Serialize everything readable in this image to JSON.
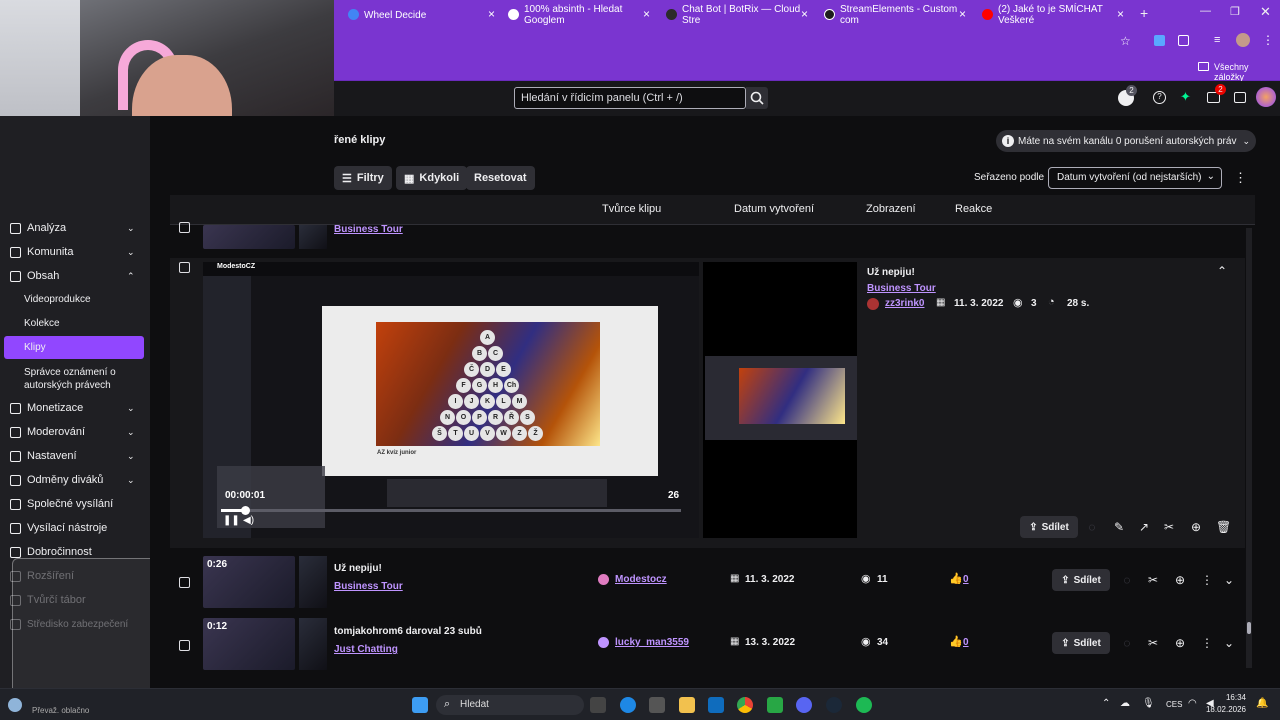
{
  "browser": {
    "tabs": [
      {
        "label": "Wheel Decide",
        "favicon_color": "#4285f4"
      },
      {
        "label": "100% absinth - Hledat Googlem",
        "favicon_color": "#ffffff"
      },
      {
        "label": "Chat Bot | BotRix — Cloud Stre",
        "favicon_color": "#2b2b2b"
      },
      {
        "label": "StreamElements - Custom com",
        "favicon_color": "#1d1d1d"
      },
      {
        "label": "(2) Jaké to je SMÍCHAT Veškeré",
        "favicon_color": "#ff0000"
      }
    ],
    "new_tab": "+",
    "bookmarks_all": "Všechny záložky"
  },
  "topnav": {
    "search_placeholder": "Hledání v řídicím panelu (Ctrl + /)",
    "notification_count": "2",
    "inbox_count": "2"
  },
  "page": {
    "title": "řené klipy",
    "copyright_notice": "Máte na svém kanálu 0 porušení autorských práv",
    "filter_label": "Filtry",
    "when_label": "Kdykoli",
    "reset_label": "Resetovat",
    "sort_label": "Seřazeno podle",
    "sort_value": "Datum vytvoření (od nejstarších)"
  },
  "columns": [
    "Tvůrce klipu",
    "Datum vytvoření",
    "Zobrazení",
    "Reakce"
  ],
  "sidebar": {
    "items": [
      {
        "label": "Analýza",
        "chev": "⌄"
      },
      {
        "label": "Komunita",
        "chev": "⌄"
      },
      {
        "label": "Obsah",
        "chev": "⌃"
      }
    ],
    "sub": [
      "Videoprodukce",
      "Kolekce",
      "Klipy",
      "Správce oznámení o autorských právech"
    ],
    "items2": [
      {
        "label": "Monetizace",
        "chev": "⌄"
      },
      {
        "label": "Moderování",
        "chev": "⌄"
      },
      {
        "label": "Nastavení",
        "chev": "⌄"
      },
      {
        "label": "Odměny diváků",
        "chev": "⌄"
      },
      {
        "label": "Společné vysílání",
        "chev": ""
      },
      {
        "label": "Vysílací nástroje",
        "chev": ""
      },
      {
        "label": "Dobročinnost",
        "chev": ""
      },
      {
        "label": "Rozšíření",
        "chev": ""
      },
      {
        "label": "Tvůrčí tábor",
        "chev": ""
      },
      {
        "label": "Středisko zabezpečení",
        "chev": ""
      }
    ]
  },
  "rows": [
    {
      "category": "Business Tour"
    },
    {
      "title": "Už nepiju!",
      "category": "Business Tour",
      "creator": "zz3rink0",
      "date": "11. 3. 2022",
      "views": "3",
      "duration": "28 s.",
      "player_time": "00:00:01",
      "player_remaining": "26",
      "share": "Sdílet",
      "player_title": "ModestoCZ"
    },
    {
      "duration": "0:26",
      "title": "Už nepiju!",
      "category": "Business Tour",
      "creator": "Modestocz",
      "date": "11. 3. 2022",
      "views": "11",
      "reactions": "0",
      "share": "Sdílet"
    },
    {
      "duration": "0:12",
      "title": "tomjakohrom6 daroval 23 subů",
      "category": "Just Chatting",
      "creator": "lucky_man3559",
      "date": "13. 3. 2022",
      "views": "34",
      "reactions": "0",
      "share": "Sdílet"
    }
  ],
  "quiz_letters": [
    "A",
    "B",
    "C",
    "Č",
    "D",
    "E",
    "F",
    "G",
    "H",
    "Ch",
    "I",
    "J",
    "K",
    "L",
    "M",
    "N",
    "O",
    "P",
    "R",
    "Ř",
    "S",
    "Š",
    "T",
    "U",
    "V",
    "W",
    "Z",
    "Ž"
  ],
  "taskbar": {
    "search": "Hledat",
    "lang": "CES",
    "time": "16:34",
    "date": "18.02.2026",
    "weather": "Převaž. oblačno"
  },
  "colors": {
    "accent": "#9147ff",
    "link": "#bf94ff",
    "browser": "#7a35d0"
  }
}
